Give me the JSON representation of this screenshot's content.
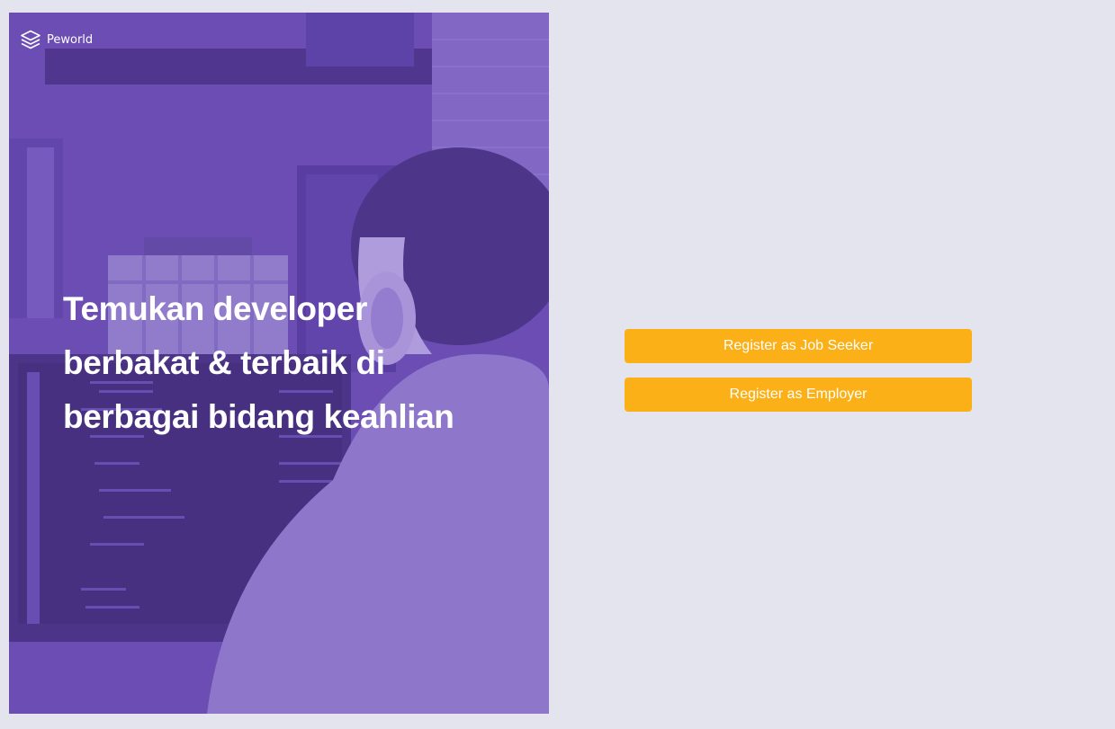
{
  "brand": {
    "name": "Peworld",
    "icon": "layers-icon"
  },
  "hero": {
    "title": "Temukan developer berbakat & terbaik di berbagai bidang keahlian",
    "overlay_color": "#6f4bbf"
  },
  "actions": {
    "job_seeker_label": "Register as Job Seeker",
    "employer_label": "Register as Employer",
    "button_color": "#fbb017"
  },
  "colors": {
    "page_background": "#e3e4ee"
  }
}
